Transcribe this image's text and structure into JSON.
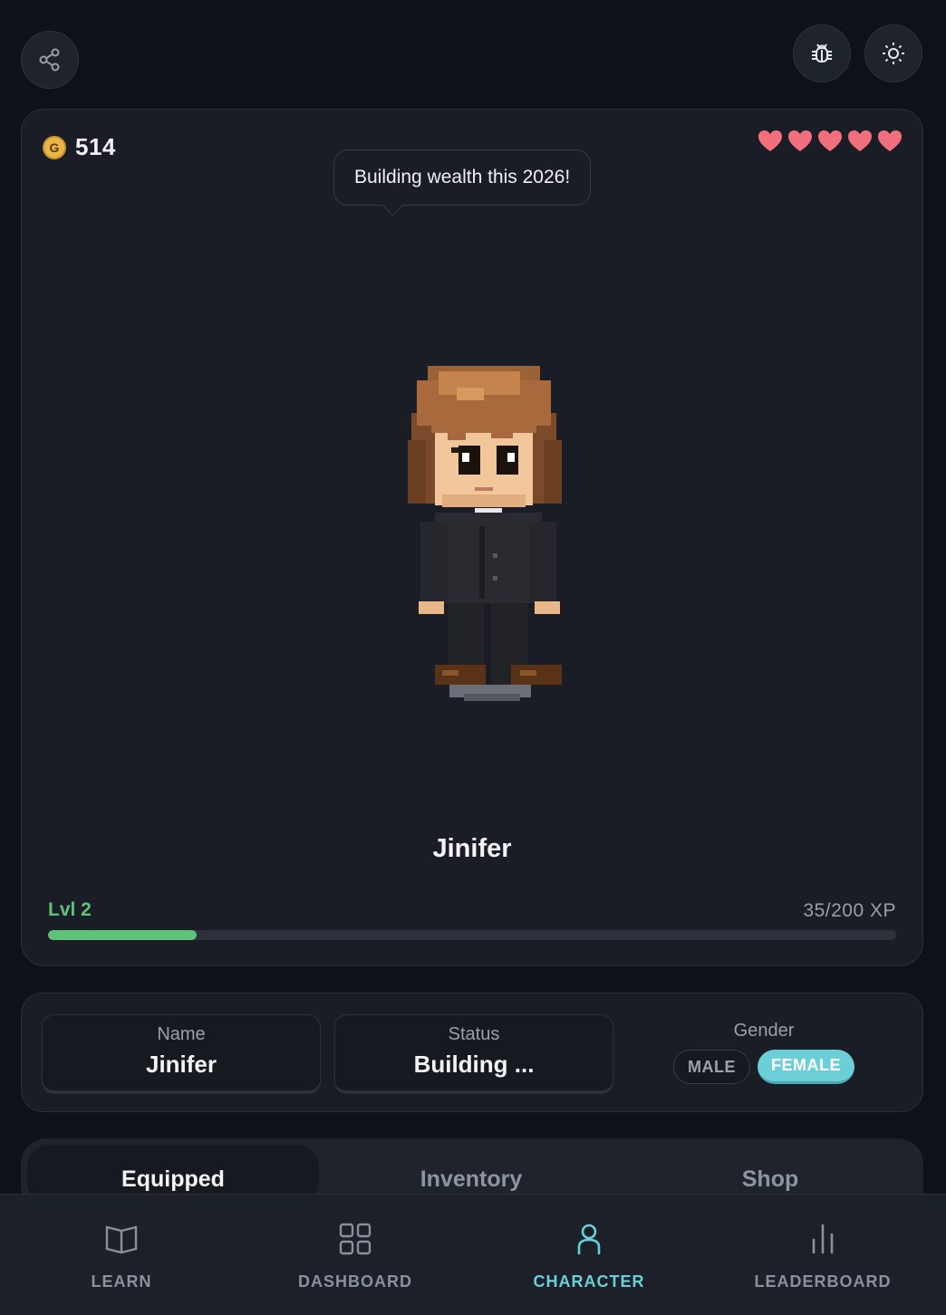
{
  "top_bar": {
    "share_icon": "share-icon",
    "bug_icon": "bug-icon",
    "theme_icon": "sun-icon"
  },
  "character_card": {
    "gold_symbol": "G",
    "gold": "514",
    "hearts": 5,
    "speech": "Building wealth this 2026!",
    "name": "Jinifer",
    "level": "Lvl 2",
    "xp_text": "35/200 XP",
    "xp_fraction": 0.175
  },
  "profile": {
    "name_label": "Name",
    "name_value": "Jinifer",
    "status_label": "Status",
    "status_value": "Building ...",
    "gender_label": "Gender",
    "gender_male": "MALE",
    "gender_female": "FEMALE",
    "gender_selected": "FEMALE"
  },
  "tabs": [
    {
      "label": "Equipped",
      "active": true
    },
    {
      "label": "Inventory",
      "active": false
    },
    {
      "label": "Shop",
      "active": false
    }
  ],
  "nav": [
    {
      "label": "LEARN",
      "icon": "book-icon",
      "active": false
    },
    {
      "label": "DASHBOARD",
      "icon": "grid-icon",
      "active": false
    },
    {
      "label": "CHARACTER",
      "icon": "person-icon",
      "active": true
    },
    {
      "label": "LEADERBOARD",
      "icon": "bar-chart-icon",
      "active": false
    }
  ],
  "colors": {
    "accent": "#6ccfd8",
    "xp": "#5fc27a",
    "heart": "#f2707e",
    "gold": "#e9b64a"
  }
}
